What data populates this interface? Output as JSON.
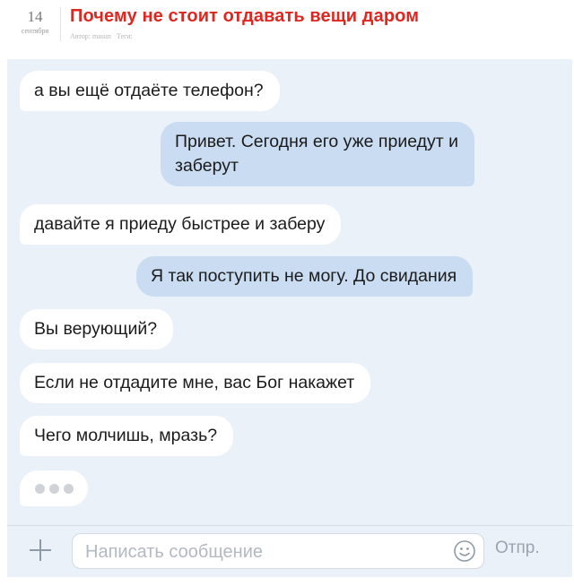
{
  "article": {
    "day": "14",
    "month": "сентября",
    "title": "Почему не стоит отдавать вещи даром",
    "author_label": "Автор: masun",
    "tags_label": "Теги:"
  },
  "messages": [
    {
      "direction": "in",
      "lines": [
        "а вы ещё отдаёте телефон?"
      ]
    },
    {
      "direction": "out",
      "lines": [
        "Привет. Сегодня его уже приедут и",
        "заберут"
      ]
    },
    {
      "direction": "in",
      "lines": [
        "давайте я приеду быстрее и заберу"
      ]
    },
    {
      "direction": "out",
      "lines": [
        "Я так поступить не могу. До свидания"
      ]
    },
    {
      "direction": "in",
      "lines": [
        "Вы верующий?"
      ]
    },
    {
      "direction": "in",
      "lines": [
        "Если не отдадите мне, вас Бог накажет"
      ]
    },
    {
      "direction": "in",
      "lines": [
        "Чего молчишь, мразь?"
      ]
    }
  ],
  "composer": {
    "placeholder": "Написать сообщение",
    "value": "",
    "send_label": "Отпр.",
    "attach_icon": "plus-icon",
    "emoji_icon": "smiley-icon"
  },
  "colors": {
    "title": "#e0261f",
    "chat_background": "#ebf1f8",
    "outgoing_bubble": "#c9dcf2",
    "incoming_bubble": "#ffffff"
  }
}
